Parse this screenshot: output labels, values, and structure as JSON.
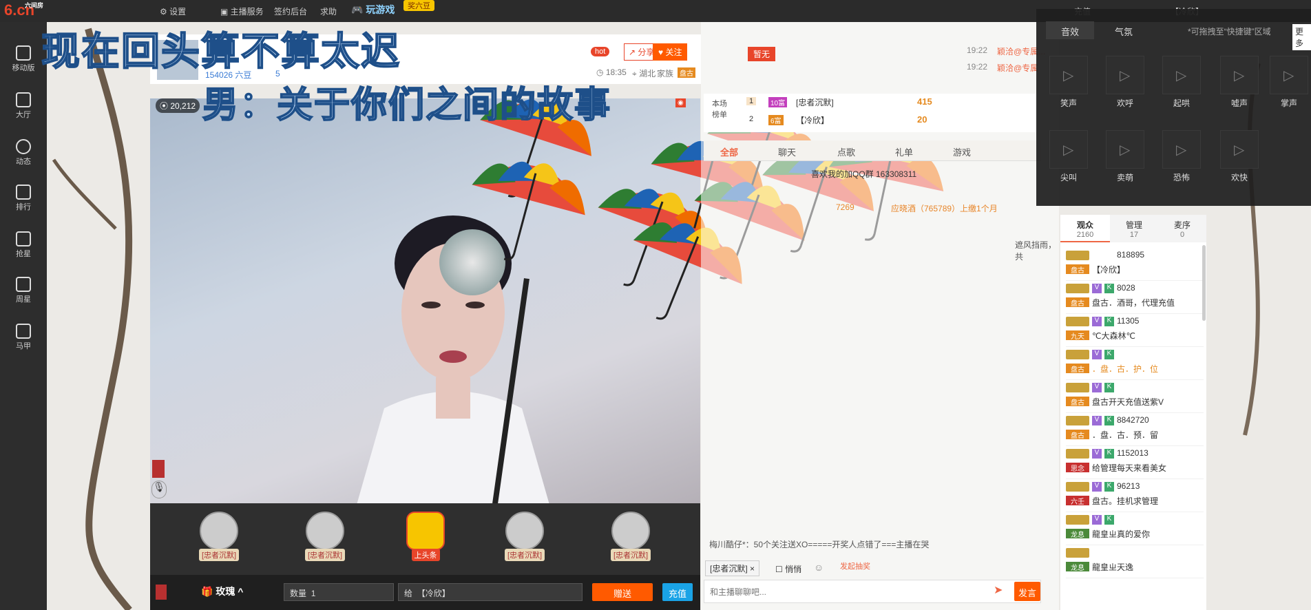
{
  "topbar": {
    "site_name": "六间房",
    "site_domain": ".cn",
    "settings": "设置",
    "anchor_service": "主播服务",
    "sign_backend": "签约后台",
    "help": "求助",
    "game": "玩游戏",
    "game_badge": "奖六豆",
    "user_status": "充值",
    "user_name": "【冷欣】"
  },
  "leftnav": [
    {
      "label": "移动版"
    },
    {
      "label": "大厅"
    },
    {
      "label": "动态"
    },
    {
      "label": "排行"
    },
    {
      "label": "抢星"
    },
    {
      "label": "周星"
    },
    {
      "label": "马甲"
    }
  ],
  "overlay": {
    "lyric_line1": "现在回头算不算太迟",
    "lyric_line2": "男：关于你们之间的故事"
  },
  "room": {
    "hot_badge": "hot",
    "share_label": "分享有奖",
    "follow_label": "关注",
    "beans": "154026 六豆",
    "star_level": "5",
    "time": "18:35",
    "location": "湖北",
    "family_label": "家族",
    "family_name": "盘古",
    "viewers_count": "20,212",
    "no_guard": "暂无"
  },
  "rank": {
    "title": "本场\n榜单",
    "rows": [
      {
        "rank": "1",
        "level": "10富",
        "name": "[忠者沉默]",
        "value": "415"
      },
      {
        "rank": "2",
        "level": "6富",
        "name": "【冷欣】",
        "value": "20"
      }
    ]
  },
  "notices": [
    {
      "time": "19:22",
      "text": "颖洽@专属..."
    },
    {
      "time": "19:22",
      "text": "颖洽@专属"
    }
  ],
  "chat_tabs": [
    {
      "label": "全部"
    },
    {
      "label": "聊天"
    },
    {
      "label": "点歌"
    },
    {
      "label": "礼单"
    },
    {
      "label": "游戏"
    }
  ],
  "chat_lines": [
    "喜欢我的加QQ群 163308311",
    "7269",
    "应晓酒（765789）上缴1个月",
    "遮风挡雨，共"
  ],
  "chat_broadcast": "梅川酷仔*：50个关注送XO=====开奖人点错了===主播在哭",
  "chat_input": {
    "target": "[忠者沉默]",
    "whisper": "悄悄",
    "lottery": "发起抽奖",
    "placeholder": "和主播聊聊吧...",
    "send": "发言"
  },
  "podium": [
    {
      "name": "[忠者沉默]"
    },
    {
      "name": "[忠者沉默]"
    },
    {
      "name": "上头条"
    },
    {
      "name": "[忠者沉默]"
    },
    {
      "name": "[忠者沉默]"
    }
  ],
  "giftbar": {
    "gift_name": "玫瑰",
    "quantity_label": "数量",
    "quantity": "1",
    "to_label": "给",
    "to_user": "【冷欣】",
    "send": "赠送",
    "recharge": "充值"
  },
  "audience_tabs": [
    {
      "label": "观众",
      "count": "2160"
    },
    {
      "label": "管理",
      "count": "17"
    },
    {
      "label": "麦序",
      "count": "0"
    }
  ],
  "audience": [
    {
      "num": "818895",
      "badge": "盘古",
      "name": "【冷欣】"
    },
    {
      "num": "8028",
      "badge": "盘古",
      "name": "盘古．酒哥，代理充值"
    },
    {
      "num": "11305",
      "badge": "九天",
      "name": "℃大森林℃"
    },
    {
      "num": "",
      "badge": "盘古",
      "name": "．盘．古．护．位"
    },
    {
      "num": "",
      "badge": "盘古",
      "name": "盘古开天充值送紫V"
    },
    {
      "num": "8842720",
      "badge": "盘古",
      "name": "．盘．古．预．留"
    },
    {
      "num": "1152013",
      "badge": "思念",
      "name": "给管理每天来看美女"
    },
    {
      "num": "96213",
      "badge": "六壬",
      "name": "盘古。挂机求管理"
    },
    {
      "num": "",
      "badge": "龙息",
      "name": "龍皇ㄓ真的爱你"
    },
    {
      "num": "",
      "badge": "龙息",
      "name": "龍皇ㄓ天逸"
    }
  ],
  "soundpanel": {
    "tab_sound": "音效",
    "tab_mood": "气氛",
    "hint": "*可拖拽至“快捷键”区域",
    "more": "更多",
    "sounds": [
      {
        "label": "笑声"
      },
      {
        "label": "欢呼"
      },
      {
        "label": "起哄"
      },
      {
        "label": "嘘声"
      },
      {
        "label": "掌声"
      },
      {
        "label": "尖叫"
      },
      {
        "label": "卖萌"
      },
      {
        "label": "恐怖"
      },
      {
        "label": "欢快"
      }
    ]
  }
}
